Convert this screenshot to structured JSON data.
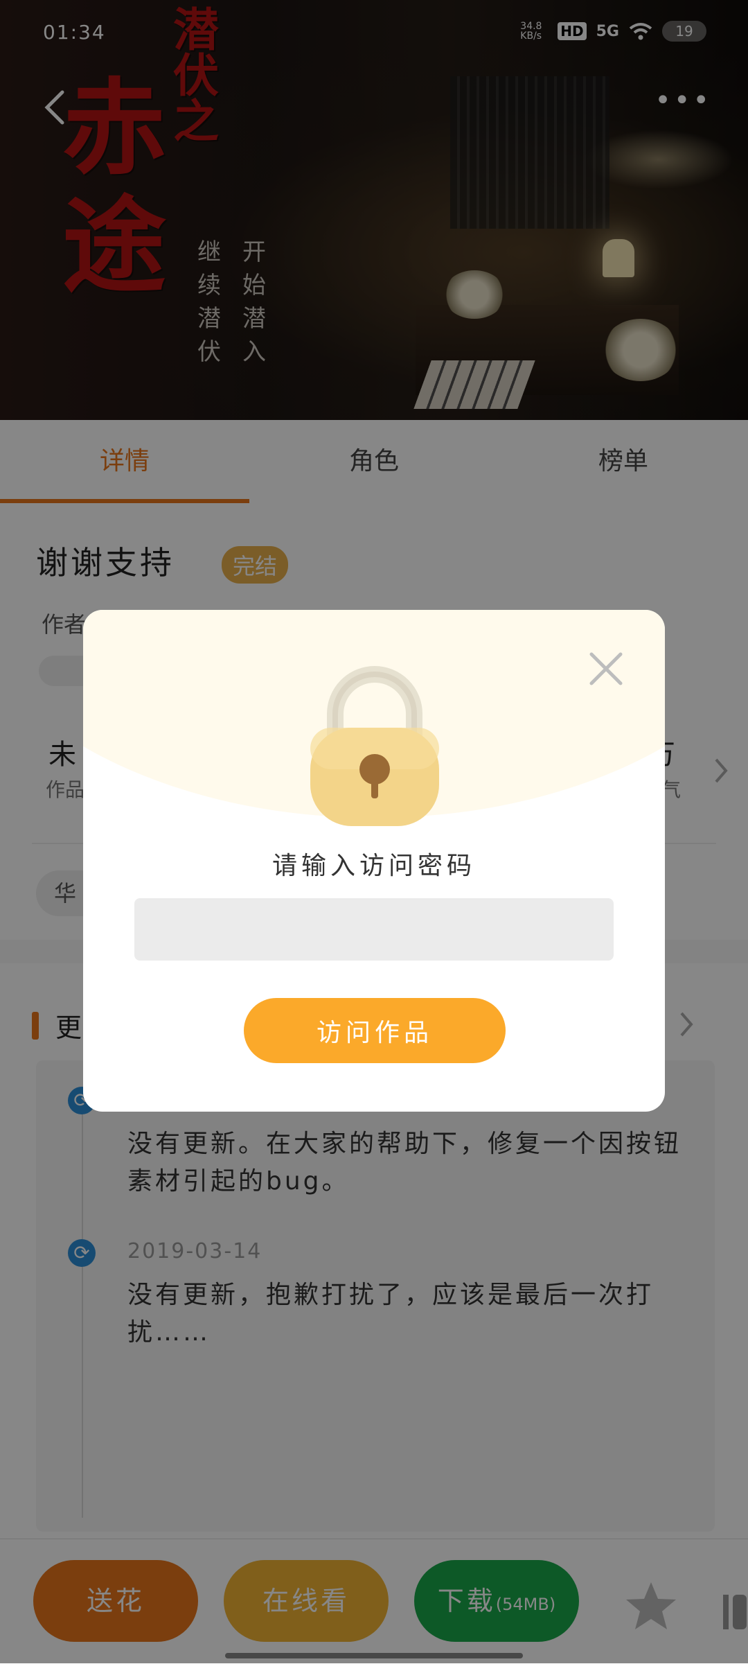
{
  "status_bar": {
    "time": "01:34",
    "net_speed": "34.8 KB/s",
    "hd": "HD",
    "signal": "5G",
    "battery": "19"
  },
  "hero": {
    "title_small": "潜伏之",
    "title_big": "赤途",
    "poem_left": "继续潜伏",
    "poem_right": "开始潜入"
  },
  "tabs": [
    {
      "label": "详情",
      "active": true
    },
    {
      "label": "角色",
      "active": false
    },
    {
      "label": "榜单",
      "active": false
    }
  ],
  "detail": {
    "title": "谢谢支持",
    "status": "完结",
    "author_label": "作者",
    "stat_left_value": "未",
    "stat_left_label": "作品",
    "stat_right_value": "万",
    "stat_right_label": "气",
    "chip_text": "华"
  },
  "updates": {
    "title": "更",
    "items": [
      {
        "date": "",
        "text": "没有更新。在大家的帮助下，修复一个因按钮素材引起的bug。"
      },
      {
        "date": "2019-03-14",
        "text": "没有更新，抱歉打扰了，应该是最后一次打扰……"
      }
    ]
  },
  "bottom_bar": {
    "flower": "送花",
    "online": "在线看",
    "download": "下载",
    "download_size": "(54MB)"
  },
  "dialog": {
    "label": "请输入访问密码",
    "input_value": "",
    "button": "访问作品"
  },
  "colors": {
    "accent": "#e8761b",
    "dialog_button": "#fba92a",
    "download": "#19a84a",
    "online": "#f1b334",
    "status_badge": "#e9b04c"
  }
}
